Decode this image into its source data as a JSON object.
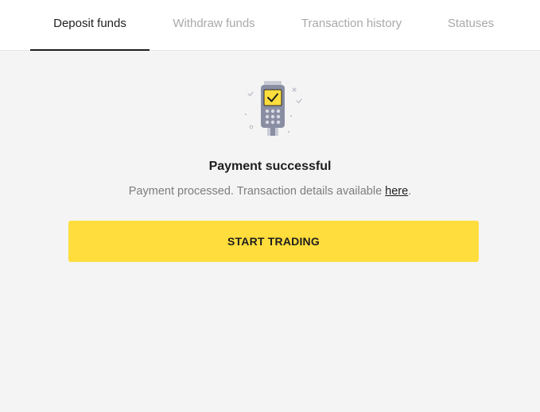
{
  "tabs": [
    {
      "label": "Deposit funds",
      "active": true
    },
    {
      "label": "Withdraw funds",
      "active": false
    },
    {
      "label": "Transaction history",
      "active": false
    },
    {
      "label": "Statuses",
      "active": false
    }
  ],
  "illustration": {
    "icon": "payment-terminal-success-icon"
  },
  "status": {
    "title": "Payment successful",
    "message": "Payment processed. Transaction details available ",
    "link_text": "here",
    "message_end": "."
  },
  "cta": {
    "label": "START TRADING"
  },
  "colors": {
    "accent": "#ffdd3c",
    "background": "#f4f4f4",
    "text_primary": "#1e1e1e",
    "text_muted": "#a9a9a9"
  }
}
